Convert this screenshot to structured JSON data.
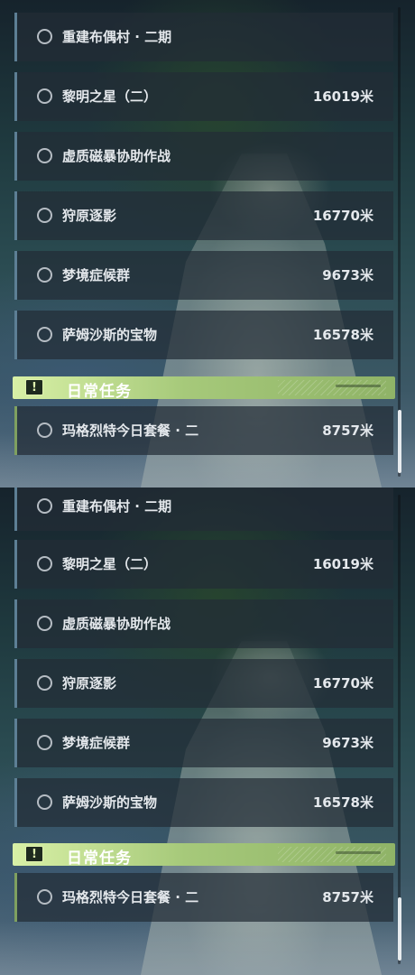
{
  "panels": [
    {
      "quests": [
        {
          "name": "重建布偶村 · 二期",
          "distance": ""
        },
        {
          "name": "黎明之星（二）",
          "distance": "16019米"
        },
        {
          "name": "虚质磁暴协助作战",
          "distance": ""
        },
        {
          "name": "狩原逐影",
          "distance": "16770米"
        },
        {
          "name": "梦境症候群",
          "distance": "9673米"
        },
        {
          "name": "萨姆沙斯的宝物",
          "distance": "16578米"
        }
      ],
      "category": {
        "icon": "!",
        "title": "日常任务"
      },
      "daily_quests": [
        {
          "name": "玛格烈特今日套餐 · 二",
          "distance": "8757米"
        }
      ]
    },
    {
      "quests": [
        {
          "name": "重建布偶村 · 二期",
          "distance": ""
        },
        {
          "name": "黎明之星（二）",
          "distance": "16019米"
        },
        {
          "name": "虚质磁暴协助作战",
          "distance": ""
        },
        {
          "name": "狩原逐影",
          "distance": "16770米"
        },
        {
          "name": "梦境症候群",
          "distance": "9673米"
        },
        {
          "name": "萨姆沙斯的宝物",
          "distance": "16578米"
        }
      ],
      "category": {
        "icon": "!",
        "title": "日常任务"
      },
      "daily_quests": [
        {
          "name": "玛格烈特今日套餐 · 二",
          "distance": "8757米"
        }
      ]
    }
  ],
  "colors": {
    "quest_bar_accent": "#5d7f95",
    "daily_bar_accent": "#7fa060",
    "category_green": "#a6c97a"
  },
  "icons": {
    "quest_marker": "radio-circle-icon",
    "category_marker": "exclamation-icon"
  }
}
